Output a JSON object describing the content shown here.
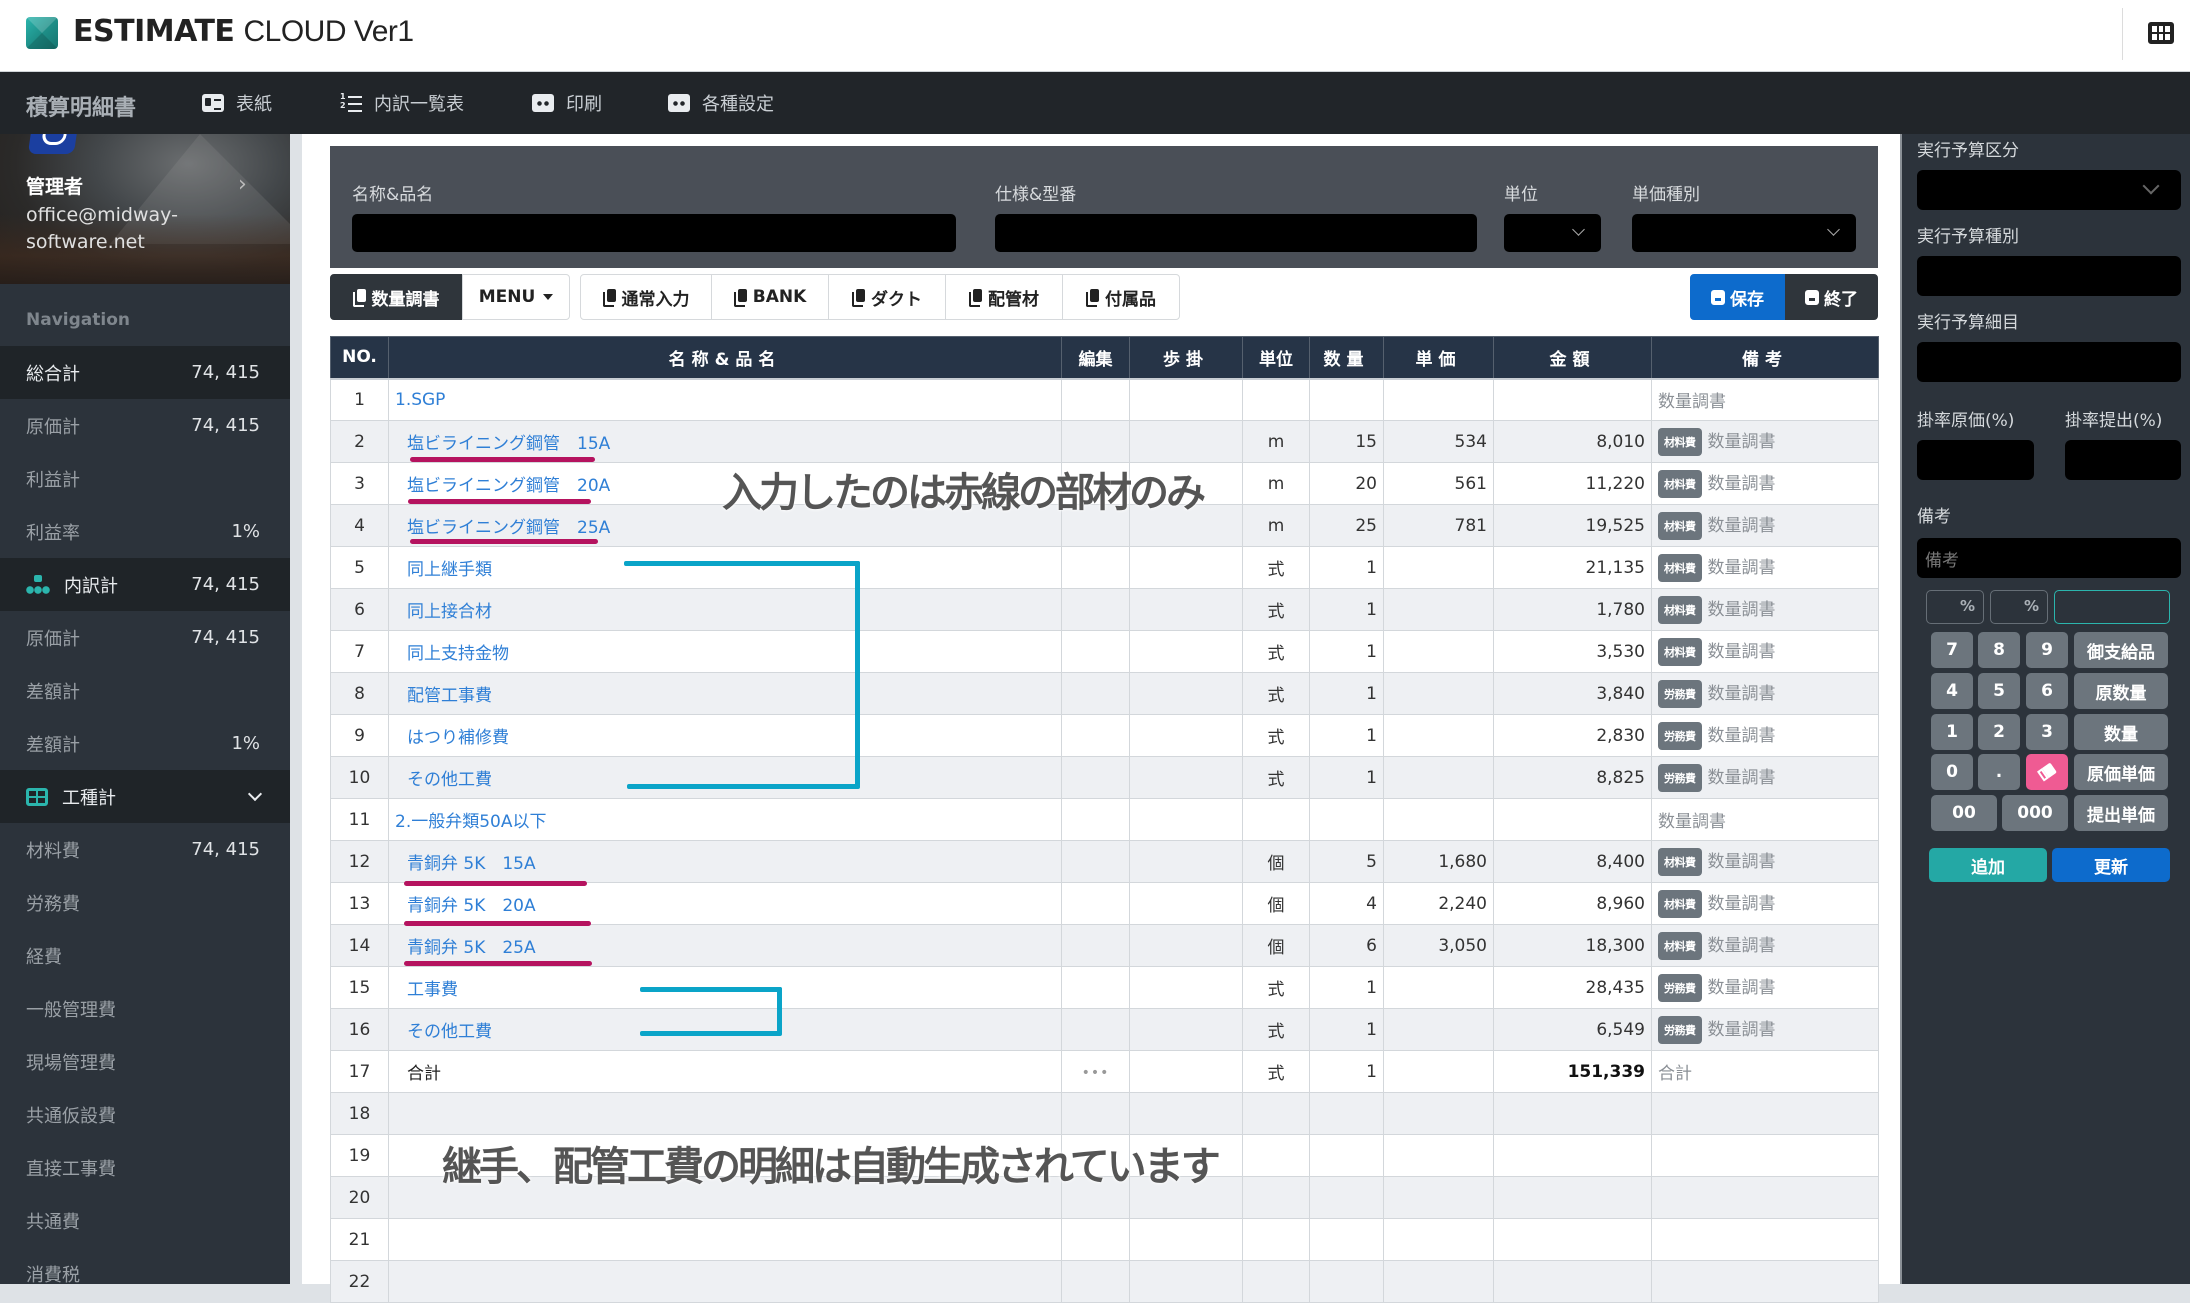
{
  "app": {
    "brand_bold": "ESTIMATE",
    "brand_light": "CLOUD Ver1",
    "grid_icon": "grid-icon"
  },
  "navbar": {
    "title": "積算明細書",
    "items": [
      {
        "label": "表紙",
        "icon": "id-card-icon"
      },
      {
        "label": "内訳一覧表",
        "icon": "ordered-list-icon"
      },
      {
        "label": "印刷",
        "icon": "print-icon"
      },
      {
        "label": "各種設定",
        "icon": "settings-icon"
      }
    ]
  },
  "sidebar": {
    "profile": {
      "name": "管理者",
      "email": "office@midway-software.net"
    },
    "navigation_label": "Navigation",
    "items": [
      {
        "label": "総合計",
        "value": "74, 415",
        "active": true
      },
      {
        "label": "原価計",
        "value": "74, 415"
      },
      {
        "label": "利益計",
        "value": ""
      },
      {
        "label": "利益率",
        "value": "1%"
      },
      {
        "label": "内訳計",
        "value": "74, 415",
        "active": true,
        "icon": "sitemap-icon"
      },
      {
        "label": "原価計",
        "value": "74, 415"
      },
      {
        "label": "差額計",
        "value": ""
      },
      {
        "label": "差額計",
        "value": "1%"
      },
      {
        "label": "工種計",
        "value": "",
        "active": true,
        "icon": "table-icon",
        "expanded": true
      },
      {
        "label": "材料費",
        "value": "74, 415"
      },
      {
        "label": "労務費",
        "value": ""
      },
      {
        "label": "経費",
        "value": ""
      },
      {
        "label": "一般管理費",
        "value": ""
      },
      {
        "label": "現場管理費",
        "value": ""
      },
      {
        "label": "共通仮設費",
        "value": ""
      },
      {
        "label": "直接工事費",
        "value": ""
      },
      {
        "label": "共通費",
        "value": ""
      },
      {
        "label": "消費税",
        "value": ""
      }
    ]
  },
  "form": {
    "name_label": "名称&品名",
    "name_value": "",
    "spec_label": "仕様&型番",
    "spec_value": "",
    "unit_label": "単位",
    "unit_value": "",
    "price_type_label": "単価種別",
    "price_type_value": ""
  },
  "toolbar": {
    "quantity_survey": "数量調書",
    "menu": "MENU",
    "normal_input": "通常入力",
    "bank": "BANK",
    "duct": "ダクト",
    "piping": "配管材",
    "accessories": "付属品",
    "save": "保存",
    "finish": "終了"
  },
  "table": {
    "headers": [
      "NO.",
      "名称&品名",
      "編集",
      "歩掛",
      "単位",
      "数量",
      "単価",
      "金額",
      "備考"
    ],
    "rows": [
      {
        "no": "1",
        "name": "1.SGP",
        "type": "group",
        "edit": "",
        "rate": "",
        "unit": "",
        "qty": "",
        "price": "",
        "amount": "",
        "badge": "",
        "remark": "数量調書"
      },
      {
        "no": "2",
        "name": "塩ビライニング鋼管　15A",
        "type": "item",
        "edit": "",
        "rate": "",
        "unit": "m",
        "qty": "15",
        "price": "534",
        "amount": "8,010",
        "badge": "材料費",
        "remark": "数量調書"
      },
      {
        "no": "3",
        "name": "塩ビライニング鋼管　20A",
        "type": "item",
        "edit": "",
        "rate": "",
        "unit": "m",
        "qty": "20",
        "price": "561",
        "amount": "11,220",
        "badge": "材料費",
        "remark": "数量調書"
      },
      {
        "no": "4",
        "name": "塩ビライニング鋼管　25A",
        "type": "item",
        "edit": "",
        "rate": "",
        "unit": "m",
        "qty": "25",
        "price": "781",
        "amount": "19,525",
        "badge": "材料費",
        "remark": "数量調書"
      },
      {
        "no": "5",
        "name": "同上継手類",
        "type": "item",
        "edit": "",
        "rate": "",
        "unit": "式",
        "qty": "1",
        "price": "",
        "amount": "21,135",
        "badge": "材料費",
        "remark": "数量調書"
      },
      {
        "no": "6",
        "name": "同上接合材",
        "type": "item",
        "edit": "",
        "rate": "",
        "unit": "式",
        "qty": "1",
        "price": "",
        "amount": "1,780",
        "badge": "材料費",
        "remark": "数量調書"
      },
      {
        "no": "7",
        "name": "同上支持金物",
        "type": "item",
        "edit": "",
        "rate": "",
        "unit": "式",
        "qty": "1",
        "price": "",
        "amount": "3,530",
        "badge": "材料費",
        "remark": "数量調書"
      },
      {
        "no": "8",
        "name": "配管工事費",
        "type": "item",
        "edit": "",
        "rate": "",
        "unit": "式",
        "qty": "1",
        "price": "",
        "amount": "3,840",
        "badge": "労務費",
        "remark": "数量調書"
      },
      {
        "no": "9",
        "name": "はつり補修費",
        "type": "item",
        "edit": "",
        "rate": "",
        "unit": "式",
        "qty": "1",
        "price": "",
        "amount": "2,830",
        "badge": "労務費",
        "remark": "数量調書"
      },
      {
        "no": "10",
        "name": "その他工費",
        "type": "item",
        "edit": "",
        "rate": "",
        "unit": "式",
        "qty": "1",
        "price": "",
        "amount": "8,825",
        "badge": "労務費",
        "remark": "数量調書"
      },
      {
        "no": "11",
        "name": "2.一般弁類50A以下",
        "type": "group",
        "edit": "",
        "rate": "",
        "unit": "",
        "qty": "",
        "price": "",
        "amount": "",
        "badge": "",
        "remark": "数量調書"
      },
      {
        "no": "12",
        "name": "青銅弁 5K　15A",
        "type": "item",
        "edit": "",
        "rate": "",
        "unit": "個",
        "qty": "5",
        "price": "1,680",
        "amount": "8,400",
        "badge": "材料費",
        "remark": "数量調書"
      },
      {
        "no": "13",
        "name": "青銅弁 5K　20A",
        "type": "item",
        "edit": "",
        "rate": "",
        "unit": "個",
        "qty": "4",
        "price": "2,240",
        "amount": "8,960",
        "badge": "材料費",
        "remark": "数量調書"
      },
      {
        "no": "14",
        "name": "青銅弁 5K　25A",
        "type": "item",
        "edit": "",
        "rate": "",
        "unit": "個",
        "qty": "6",
        "price": "3,050",
        "amount": "18,300",
        "badge": "材料費",
        "remark": "数量調書"
      },
      {
        "no": "15",
        "name": "工事費",
        "type": "item",
        "edit": "",
        "rate": "",
        "unit": "式",
        "qty": "1",
        "price": "",
        "amount": "28,435",
        "badge": "労務費",
        "remark": "数量調書"
      },
      {
        "no": "16",
        "name": "その他工費",
        "type": "item",
        "edit": "",
        "rate": "",
        "unit": "式",
        "qty": "1",
        "price": "",
        "amount": "6,549",
        "badge": "労務費",
        "remark": "数量調書"
      },
      {
        "no": "17",
        "name": "合計",
        "type": "total",
        "edit": "•••",
        "rate": "",
        "unit": "式",
        "qty": "1",
        "price": "",
        "amount": "151,339",
        "badge": "",
        "remark": "合計"
      },
      {
        "no": "18",
        "name": "",
        "type": "empty",
        "edit": "",
        "rate": "",
        "unit": "",
        "qty": "",
        "price": "",
        "amount": "",
        "badge": "",
        "remark": ""
      },
      {
        "no": "19",
        "name": "",
        "type": "empty",
        "edit": "",
        "rate": "",
        "unit": "",
        "qty": "",
        "price": "",
        "amount": "",
        "badge": "",
        "remark": ""
      },
      {
        "no": "20",
        "name": "",
        "type": "empty",
        "edit": "",
        "rate": "",
        "unit": "",
        "qty": "",
        "price": "",
        "amount": "",
        "badge": "",
        "remark": ""
      },
      {
        "no": "21",
        "name": "",
        "type": "empty",
        "edit": "",
        "rate": "",
        "unit": "",
        "qty": "",
        "price": "",
        "amount": "",
        "badge": "",
        "remark": ""
      },
      {
        "no": "22",
        "name": "",
        "type": "empty",
        "edit": "",
        "rate": "",
        "unit": "",
        "qty": "",
        "price": "",
        "amount": "",
        "badge": "",
        "remark": ""
      }
    ]
  },
  "annotations": {
    "top": "入力したのは赤線の部材のみ",
    "bottom": "継手、配管工費の明細は自動生成されています",
    "red_underline_rows": [
      "2",
      "3",
      "4",
      "12",
      "13",
      "14"
    ],
    "red_color": "#b5135f",
    "blue_color": "#0aa4c8"
  },
  "right_panel": {
    "budget_category_label": "実行予算区分",
    "budget_category_value": "",
    "budget_type_label": "実行予算種別",
    "budget_type_value": "",
    "budget_detail_label": "実行予算細目",
    "budget_detail_value": "",
    "rate_cost_label": "掛率原価(%)",
    "rate_cost_value": "",
    "rate_submit_label": "掛率提出(%)",
    "rate_submit_value": "",
    "remarks_label": "備考",
    "remarks_placeholder": "備考",
    "pct1": "%",
    "pct2": "%",
    "calc_display": "",
    "keys": {
      "k7": "7",
      "k8": "8",
      "k9": "9",
      "supplied": "御支給品",
      "k4": "4",
      "k5": "5",
      "k6": "6",
      "orig_qty": "原数量",
      "k1": "1",
      "k2": "2",
      "k3": "3",
      "qty": "数量",
      "k0": "0",
      "dot": ".",
      "clear": "eraser-icon",
      "cost_price": "原価単価",
      "k00": "00",
      "k000": "000",
      "submit_price": "提出単価"
    },
    "add": "追加",
    "update": "更新"
  },
  "colors": {
    "accent_teal": "#2bb5ad",
    "primary_blue": "#0d6bcc",
    "header_navy": "#263447",
    "link_blue": "#2f7fd6",
    "danger_pink": "#ef5b93"
  }
}
